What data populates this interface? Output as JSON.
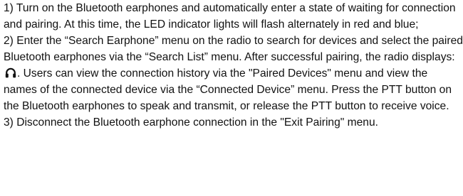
{
  "document": {
    "steps": [
      {
        "text": "1) Turn on the Bluetooth earphones and automatically enter a state of waiting for connection and pairing. At this time, the LED indicator lights will flash alternately in red and blue;"
      },
      {
        "text_before_icon": "2) Enter the “Search Earphone” menu on the radio to search for devices and select the paired Bluetooth earphones via the “Search List” menu. After successful pairing, the radio displays: ",
        "icon": "headphone-icon",
        "text_after_icon": ". Users can view the connection history via the \"Paired Devices\" menu and view the names of the connected device via the “Connected Device” menu. Press the PTT button on the Bluetooth earphones to speak and transmit, or release the PTT button to receive voice."
      },
      {
        "text": "3) Disconnect the Bluetooth earphone connection in the \"Exit Pairing\" menu."
      }
    ]
  }
}
